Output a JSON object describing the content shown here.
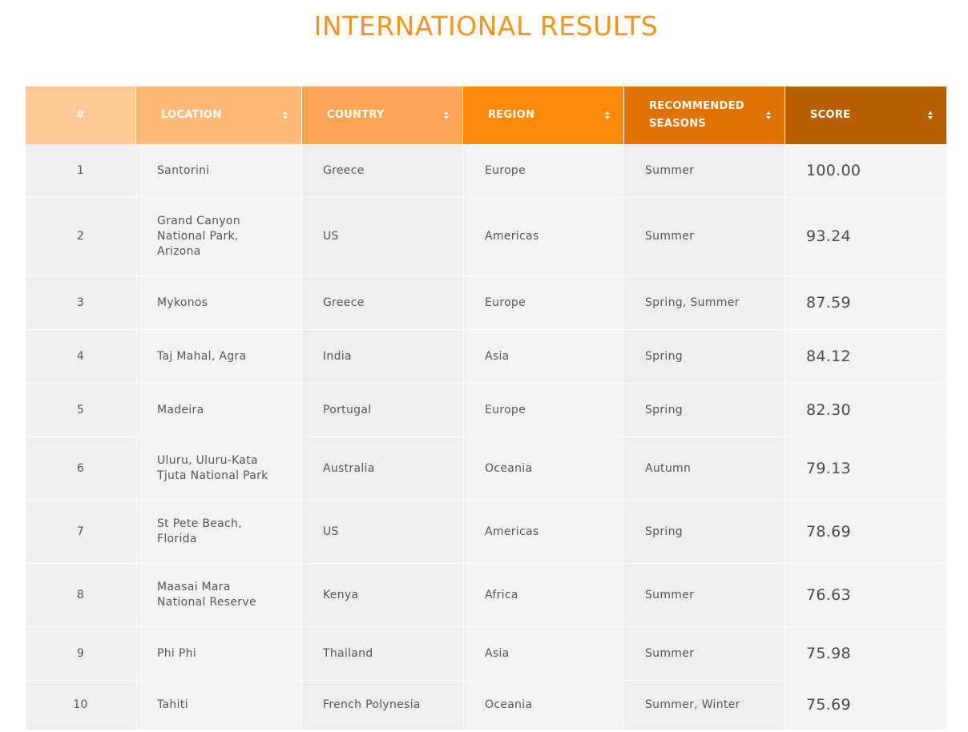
{
  "page": {
    "title": "INTERNATIONAL RESULTS"
  },
  "colors": {
    "title": "#f7931e",
    "header_rank": "#fdc896",
    "header_location": "#ffb978",
    "header_country": "#fda556",
    "header_region": "#fd8a09",
    "header_season": "#de7306",
    "header_score": "#b76104",
    "row_bg": "#efefef",
    "text": "#555555"
  },
  "table": {
    "headers": {
      "rank": "#",
      "location": "LOCATION",
      "country": "COUNTRY",
      "region": "REGION",
      "season_line1": "RECOMMENDED",
      "season_line2": "SEASONS",
      "score": "SCORE"
    },
    "sort_icon": "sort-arrows-icon",
    "rows": [
      {
        "rank": "1",
        "location": [
          "Santorini"
        ],
        "country": "Greece",
        "region": "Europe",
        "season": "Summer",
        "score": "100.00"
      },
      {
        "rank": "2",
        "location": [
          "Grand Canyon",
          "National Park,",
          "Arizona"
        ],
        "country": "US",
        "region": "Americas",
        "season": "Summer",
        "score": "93.24"
      },
      {
        "rank": "3",
        "location": [
          "Mykonos"
        ],
        "country": "Greece",
        "region": "Europe",
        "season": "Spring, Summer",
        "score": "87.59"
      },
      {
        "rank": "4",
        "location": [
          "Taj Mahal, Agra"
        ],
        "country": "India",
        "region": "Asia",
        "season": "Spring",
        "score": "84.12"
      },
      {
        "rank": "5",
        "location": [
          "Madeira"
        ],
        "country": "Portugal",
        "region": "Europe",
        "season": "Spring",
        "score": "82.30"
      },
      {
        "rank": "6",
        "location": [
          "Uluru, Uluru-Kata",
          "Tjuta National Park"
        ],
        "country": "Australia",
        "region": "Oceania",
        "season": "Autumn",
        "score": "79.13"
      },
      {
        "rank": "7",
        "location": [
          "St Pete Beach,",
          "Florida"
        ],
        "country": "US",
        "region": "Americas",
        "season": "Spring",
        "score": "78.69"
      },
      {
        "rank": "8",
        "location": [
          "Maasai Mara",
          "National Reserve"
        ],
        "country": "Kenya",
        "region": "Africa",
        "season": "Summer",
        "score": "76.63"
      },
      {
        "rank": "9",
        "location": [
          "Phi Phi"
        ],
        "country": "Thailand",
        "region": "Asia",
        "season": "Summer",
        "score": "75.98"
      },
      {
        "rank": "10",
        "location": [
          "Tahiti"
        ],
        "country": "French Polynesia",
        "region": "Oceania",
        "season": "Summer, Winter",
        "score": "75.69"
      }
    ]
  }
}
